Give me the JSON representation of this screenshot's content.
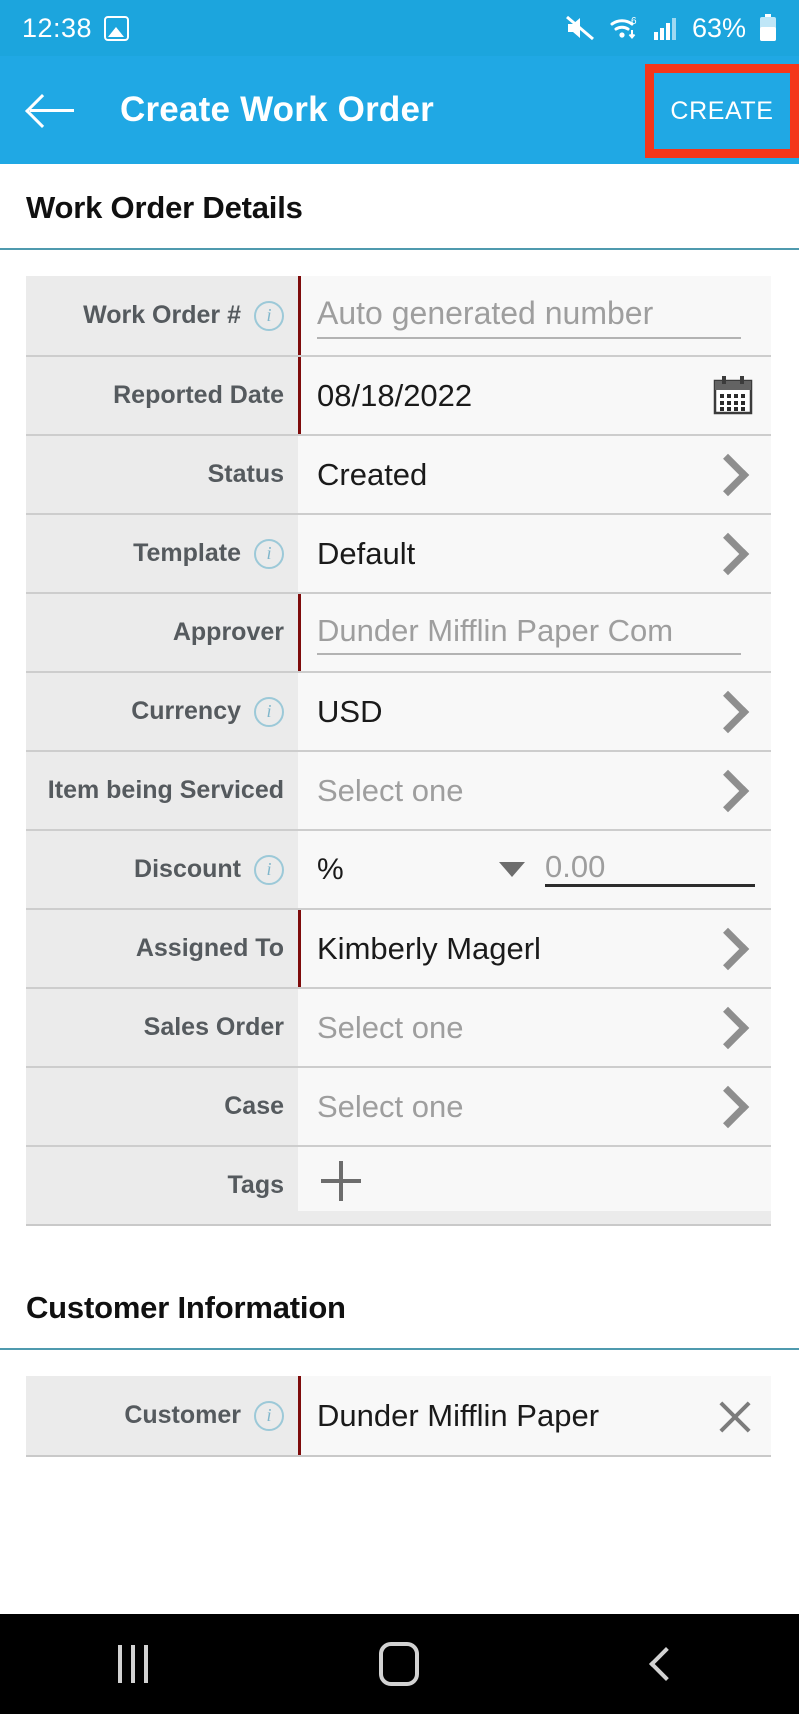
{
  "statusbar": {
    "time": "12:38",
    "battery": "63%",
    "icons": [
      "photo-icon",
      "mute-icon",
      "wifi-icon",
      "signal-icon",
      "battery-icon"
    ]
  },
  "appbar": {
    "title": "Create Work Order",
    "back_label": "back-arrow",
    "create_label": "CREATE"
  },
  "sections": [
    {
      "title": "Work Order Details"
    },
    {
      "title": "Customer Information"
    }
  ],
  "work_order_details": {
    "rows": [
      {
        "label": "Work Order #",
        "info": true,
        "required": true,
        "value": "Auto generated number",
        "placeholder": true,
        "control": "input"
      },
      {
        "label": "Reported Date",
        "info": false,
        "required": true,
        "value": "08/18/2022",
        "placeholder": false,
        "control": "calendar"
      },
      {
        "label": "Status",
        "info": false,
        "required": false,
        "value": "Created",
        "placeholder": false,
        "control": "chevron"
      },
      {
        "label": "Template",
        "info": true,
        "required": false,
        "value": "Default",
        "placeholder": false,
        "control": "chevron"
      },
      {
        "label": "Approver",
        "info": false,
        "required": true,
        "value": "Dunder Mifflin Paper Com",
        "placeholder": true,
        "control": "input"
      },
      {
        "label": "Currency",
        "info": true,
        "required": false,
        "value": "USD",
        "placeholder": false,
        "control": "chevron"
      },
      {
        "label": "Item being Serviced",
        "info": false,
        "required": false,
        "value": "Select one",
        "placeholder": true,
        "control": "chevron"
      },
      {
        "label": "Discount",
        "info": true,
        "required": false,
        "value": "",
        "placeholder": false,
        "control": "discount"
      },
      {
        "label": "Assigned To",
        "info": false,
        "required": true,
        "value": "Kimberly Magerl",
        "placeholder": false,
        "control": "chevron"
      },
      {
        "label": "Sales Order",
        "info": false,
        "required": false,
        "value": "Select one",
        "placeholder": true,
        "control": "chevron"
      },
      {
        "label": "Case",
        "info": false,
        "required": false,
        "value": "Select one",
        "placeholder": true,
        "control": "chevron"
      },
      {
        "label": "Tags",
        "info": false,
        "required": false,
        "value": "",
        "placeholder": false,
        "control": "plus"
      }
    ]
  },
  "discount": {
    "unit": "%",
    "amount": "0.00"
  },
  "customer_information": {
    "rows": [
      {
        "label": "Customer",
        "info": true,
        "required": true,
        "value": "Dunder Mifflin Paper",
        "placeholder": false,
        "control": "clear"
      }
    ]
  },
  "navbar": {
    "recents_label": "recents-button",
    "home_label": "home-button",
    "back_label": "back-button"
  },
  "colors": {
    "status_bar": "#1ca5dd",
    "app_bar": "#20a8e4",
    "highlight": "#f4361a",
    "required_marker": "#7e0b0b",
    "section_rule": "#4f9aae",
    "label_bg": "#ebebeb",
    "value_bg": "#f8f8f8"
  }
}
